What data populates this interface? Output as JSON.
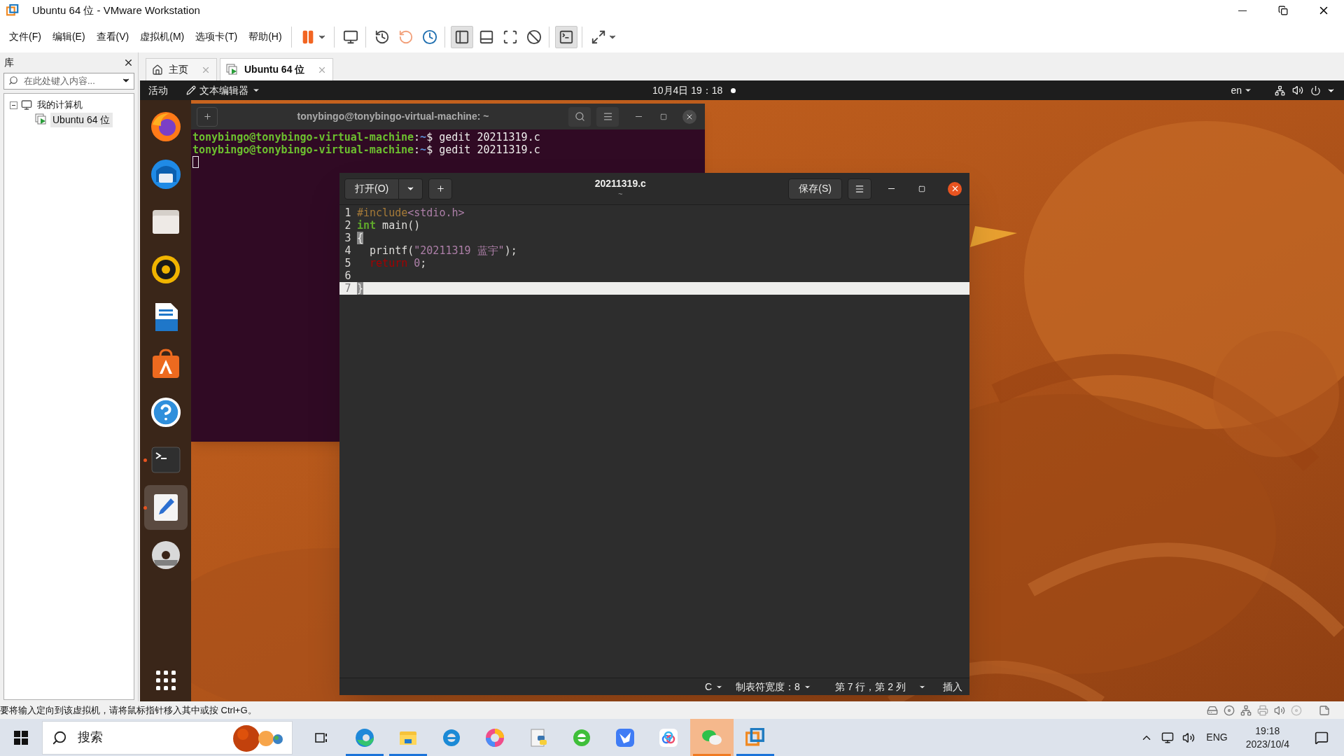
{
  "window": {
    "title": "Ubuntu 64 位 - VMware Workstation"
  },
  "menu": [
    "文件(F)",
    "编辑(E)",
    "查看(V)",
    "虚拟机(M)",
    "选项卡(T)",
    "帮助(H)"
  ],
  "toolbar": [
    [
      {
        "kind": "pause",
        "selected": false
      }
    ],
    [
      {
        "kind": "send-keys",
        "selected": false
      }
    ],
    [
      {
        "kind": "snapshot",
        "selected": false
      },
      {
        "kind": "revert",
        "selected": false
      },
      {
        "kind": "snapshot-manager",
        "selected": false
      }
    ],
    [
      {
        "kind": "library-view",
        "selected": true
      },
      {
        "kind": "thumbnail-view",
        "selected": false
      },
      {
        "kind": "fullscreen",
        "selected": false
      },
      {
        "kind": "unity",
        "selected": false
      }
    ],
    [
      {
        "kind": "console",
        "selected": true
      }
    ],
    [
      {
        "kind": "stretch",
        "selected": false
      }
    ]
  ],
  "library": {
    "title": "库",
    "search": {
      "placeholder": "在此处键入内容..."
    },
    "tree": [
      {
        "label": "我的计算机",
        "expanded": true,
        "selected": false,
        "children": [
          {
            "label": "Ubuntu 64 位",
            "selected": true
          }
        ]
      }
    ]
  },
  "tabs": [
    {
      "label": "主页",
      "kind": "home",
      "selected": false
    },
    {
      "label": "Ubuntu 64 位",
      "kind": "vm",
      "selected": true
    }
  ],
  "top_bar": {
    "activities": "活动",
    "app_menu": "文本编辑器",
    "clock": "10月4日 19：18",
    "language": "en"
  },
  "dock": [
    {
      "kind": "firefox",
      "running": false,
      "selected": false
    },
    {
      "kind": "thunderbird",
      "running": false,
      "selected": false
    },
    {
      "kind": "files",
      "running": false,
      "selected": false
    },
    {
      "kind": "rhythmbox",
      "running": false,
      "selected": false
    },
    {
      "kind": "writer",
      "running": false,
      "selected": false
    },
    {
      "kind": "software",
      "running": false,
      "selected": false
    },
    {
      "kind": "help",
      "running": false,
      "selected": false
    },
    {
      "kind": "terminal",
      "running": true,
      "selected": false
    },
    {
      "kind": "editor",
      "running": true,
      "selected": true
    },
    {
      "kind": "dvd",
      "running": false,
      "selected": false
    }
  ],
  "terminal": {
    "title": "tonybingo@tonybingo-virtual-machine: ~",
    "lines": [
      {
        "tokens": [
          {
            "kind": "user",
            "text": "tonybingo@tonybingo-virtual-machine"
          },
          {
            "kind": "plain",
            "text": ":"
          },
          {
            "kind": "path",
            "text": "~"
          },
          {
            "kind": "plain",
            "text": "$ gedit 20211319.c"
          }
        ]
      },
      {
        "tokens": [
          {
            "kind": "user",
            "text": "tonybingo@tonybingo-virtual-machine"
          },
          {
            "kind": "plain",
            "text": ":"
          },
          {
            "kind": "path",
            "text": "~"
          },
          {
            "kind": "plain",
            "text": "$ gedit 20211319.c"
          }
        ]
      }
    ]
  },
  "editor": {
    "open_button": "打开(O)",
    "title": "20211319.c",
    "subtitle": "~",
    "save_button": "保存(S)",
    "lines": [
      {
        "number": "1",
        "selected": false,
        "tokens": [
          {
            "kind": "preprocessor",
            "text": "#include"
          },
          {
            "kind": "string",
            "text": "<stdio.h>"
          }
        ]
      },
      {
        "number": "2",
        "selected": false,
        "tokens": [
          {
            "kind": "type",
            "text": "int"
          },
          {
            "kind": "plain",
            "text": " main()"
          }
        ]
      },
      {
        "number": "3",
        "selected": false,
        "tokens": [
          {
            "kind": "matched_bracket",
            "text": "{"
          }
        ]
      },
      {
        "number": "4",
        "selected": false,
        "tokens": [
          {
            "kind": "plain",
            "text": "  printf("
          },
          {
            "kind": "string",
            "text": "\"20211319 蓝宇\""
          },
          {
            "kind": "plain",
            "text": ");"
          }
        ]
      },
      {
        "number": "5",
        "selected": false,
        "tokens": [
          {
            "kind": "keyword",
            "text": "  return"
          },
          {
            "kind": "number",
            "text": " 0"
          },
          {
            "kind": "plain",
            "text": ";"
          }
        ]
      },
      {
        "number": "6",
        "selected": false
      },
      {
        "number": "7",
        "selected": true,
        "tokens": [
          {
            "kind": "matched_bracket",
            "text": "}"
          }
        ]
      }
    ],
    "status": {
      "language": "C",
      "tab_width": "制表符宽度：8",
      "position": "第 7 行，第 2 列",
      "mode": "插入"
    }
  },
  "status_bar": "要将输入定向到该虚拟机，请将鼠标指针移入其中或按 Ctrl+G。",
  "taskbar": {
    "search": {
      "placeholder": "搜索"
    },
    "apps": [
      {
        "kind": "task-view",
        "running": false,
        "selected": false
      },
      {
        "kind": "edge",
        "running": true,
        "selected": false
      },
      {
        "kind": "explorer",
        "running": true,
        "selected": false
      },
      {
        "kind": "ie",
        "running": false,
        "selected": false
      },
      {
        "kind": "color-wheel",
        "running": false,
        "selected": false
      },
      {
        "kind": "python",
        "running": false,
        "selected": false
      },
      {
        "kind": "browser360",
        "running": false,
        "selected": false
      },
      {
        "kind": "bird",
        "running": false,
        "selected": false
      },
      {
        "kind": "cloud",
        "running": false,
        "selected": false
      },
      {
        "kind": "wechat",
        "running": true,
        "selected": true
      },
      {
        "kind": "vmware",
        "running": true,
        "selected": false
      }
    ],
    "language": "ENG",
    "time": "19:18",
    "date": "2023/10/4"
  }
}
